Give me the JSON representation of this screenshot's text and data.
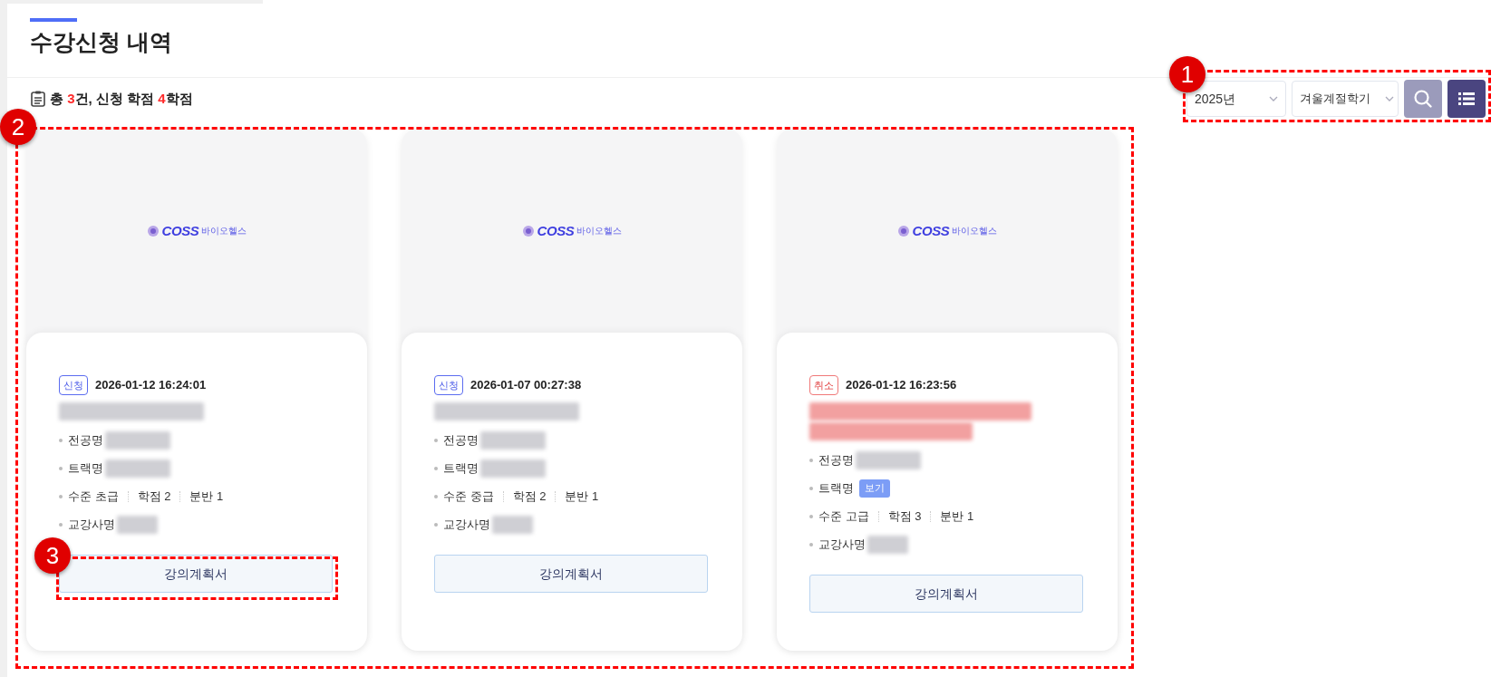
{
  "page": {
    "title": "수강신청 내역"
  },
  "summary": [
    {
      "text": "총 ",
      "highlight": false
    },
    {
      "text": "3",
      "highlight": true
    },
    {
      "text": "건, 신청 학점 ",
      "highlight": false
    },
    {
      "text": "4",
      "highlight": true
    },
    {
      "text": "학점",
      "highlight": false
    }
  ],
  "filters": {
    "year": "2025년",
    "semester": "겨울계절학기"
  },
  "cards": [
    {
      "logo": {
        "mark": "COSS",
        "text": "바이오헬스"
      },
      "status": {
        "kind": "applied",
        "label": "신청"
      },
      "datetime": "2026-01-12 16:24:01",
      "title": {
        "kind": "redacted"
      },
      "fields": [
        {
          "kind": "redacted",
          "label": "전공명"
        },
        {
          "kind": "redacted",
          "label": "트랙명"
        },
        {
          "kind": "specs",
          "items": [
            "수준 초급",
            "학점 2",
            "분반 1"
          ]
        },
        {
          "kind": "redacted",
          "label": "교강사명"
        }
      ],
      "button": "강의계획서"
    },
    {
      "logo": {
        "mark": "COSS",
        "text": "바이오헬스"
      },
      "status": {
        "kind": "applied",
        "label": "신청"
      },
      "datetime": "2026-01-07 00:27:38",
      "title": {
        "kind": "redacted"
      },
      "fields": [
        {
          "kind": "redacted",
          "label": "전공명"
        },
        {
          "kind": "redacted",
          "label": "트랙명"
        },
        {
          "kind": "specs",
          "items": [
            "수준 중급",
            "학점 2",
            "분반 1"
          ]
        },
        {
          "kind": "redacted",
          "label": "교강사명"
        }
      ],
      "button": "강의계획서"
    },
    {
      "logo": {
        "mark": "COSS",
        "text": "바이오헬스"
      },
      "status": {
        "kind": "cancelled",
        "label": "취소"
      },
      "datetime": "2026-01-12 16:23:56",
      "title": {
        "kind": "redacted_wrapped"
      },
      "fields": [
        {
          "kind": "redacted",
          "label": "전공명"
        },
        {
          "kind": "link",
          "label": "트랙명",
          "link": "보기"
        },
        {
          "kind": "specs",
          "items": [
            "수준 고급",
            "학점 3",
            "분반 1"
          ]
        },
        {
          "kind": "redacted",
          "label": "교강사명"
        }
      ],
      "button": "강의계획서"
    }
  ],
  "annotations": [
    {
      "label": "1"
    },
    {
      "label": "2"
    },
    {
      "label": "3"
    }
  ]
}
